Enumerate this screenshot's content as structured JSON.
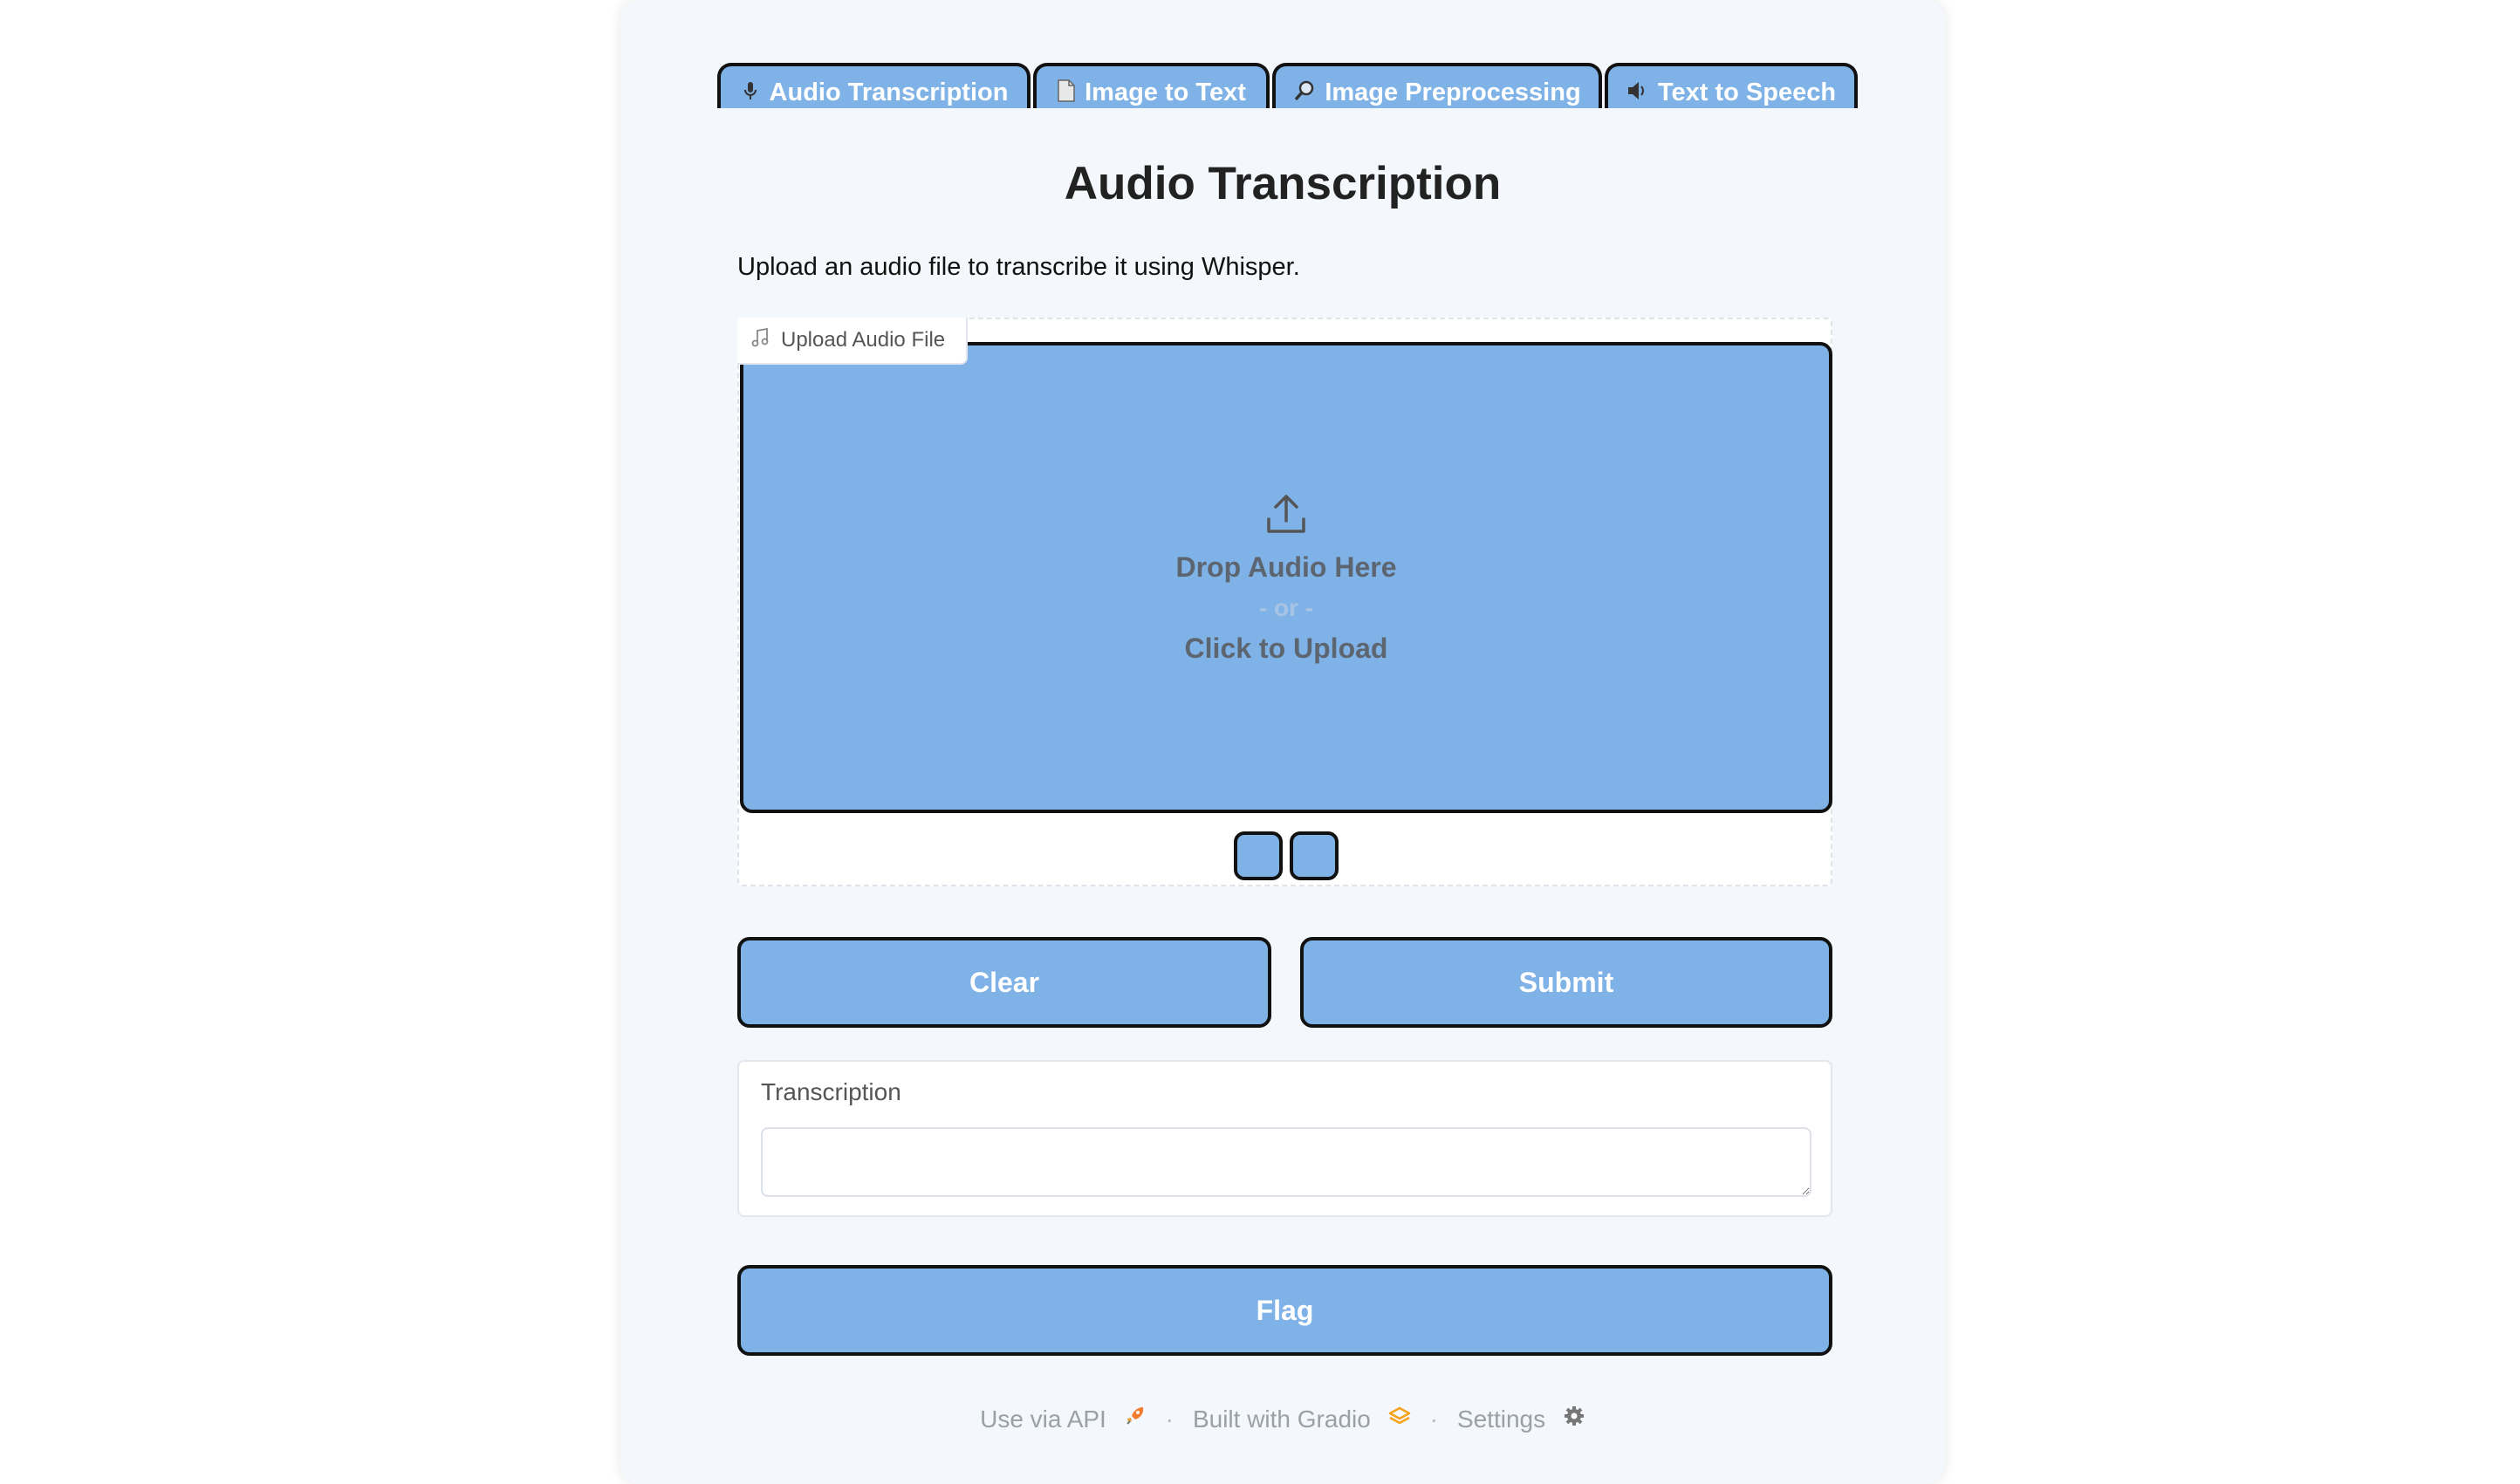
{
  "tabs": [
    {
      "label": "Audio Transcription",
      "icon": "microphone-icon"
    },
    {
      "label": "Image to Text",
      "icon": "document-icon"
    },
    {
      "label": "Image Preprocessing",
      "icon": "magnifier-icon"
    },
    {
      "label": "Text to Speech",
      "icon": "speaker-icon"
    }
  ],
  "page": {
    "title": "Audio Transcription",
    "description": "Upload an audio file to transcribe it using Whisper."
  },
  "upload": {
    "label": "Upload Audio File",
    "drop_text": "Drop Audio Here",
    "or_text": "- or -",
    "click_text": "Click to Upload"
  },
  "actions": {
    "clear": "Clear",
    "submit": "Submit",
    "flag": "Flag"
  },
  "output": {
    "label": "Transcription",
    "value": ""
  },
  "footer": {
    "api": "Use via API",
    "separator": "·",
    "built": "Built with Gradio",
    "settings": "Settings"
  },
  "colors": {
    "accent": "#7fb2e6",
    "border": "#111111",
    "panel_bg": "#f4f7fb"
  }
}
